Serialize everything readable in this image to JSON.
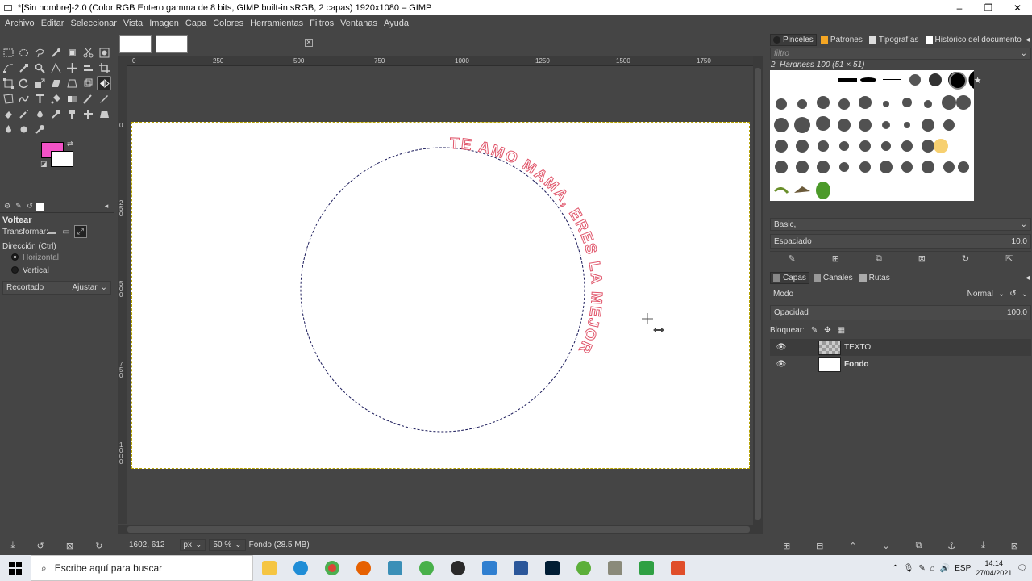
{
  "window": {
    "title": "*[Sin nombre]-2.0 (Color RGB Entero gamma de 8 bits, GIMP built-in sRGB, 2 capas) 1920x1080 – GIMP",
    "minimize": "–",
    "maximize": "❐",
    "close": "✕"
  },
  "menu": [
    "Archivo",
    "Editar",
    "Seleccionar",
    "Vista",
    "Imagen",
    "Capa",
    "Colores",
    "Herramientas",
    "Filtros",
    "Ventanas",
    "Ayuda"
  ],
  "colors": {
    "foreground": "#f252c6",
    "background": "#ffffff",
    "text_outline": "#e0556a",
    "accent": "#f5a623"
  },
  "tool_options": {
    "title": "Voltear",
    "transform_label": "Transformar:",
    "direction_label": "Dirección (Ctrl)",
    "horizontal": "Horizontal",
    "vertical": "Vertical",
    "clipping_label": "Recortado",
    "clipping_value": "Ajustar"
  },
  "rulers": {
    "top": [
      "0",
      "250",
      "500",
      "750",
      "1000",
      "1250",
      "1500",
      "1750"
    ],
    "left": [
      "0",
      "2 5 0",
      "5 0 0",
      "7 5 0",
      "1 0 0 0"
    ]
  },
  "canvas": {
    "circle_text": "TE AMO MAMA, ERES LA MEJOR"
  },
  "statusbar": {
    "coords": "1602, 612",
    "unit": "px",
    "zoom": "50 %",
    "layer_info": "Fondo (28.5 MB)"
  },
  "brushes": {
    "tabs": [
      "Pinceles",
      "Patrones",
      "Tipografías",
      "Histórico del documento"
    ],
    "filter_placeholder": "filtro",
    "current": "2. Hardness 100 (51 × 51)",
    "preset": "Basic,",
    "spacing_label": "Espaciado",
    "spacing_value": "10.0"
  },
  "layers": {
    "tabs": [
      "Capas",
      "Canales",
      "Rutas"
    ],
    "mode_label": "Modo",
    "mode_value": "Normal",
    "opacity_label": "Opacidad",
    "opacity_value": "100.0",
    "lock_label": "Bloquear:",
    "items": [
      {
        "name": "TEXTO"
      },
      {
        "name": "Fondo"
      }
    ]
  },
  "taskbar": {
    "search_placeholder": "Escribe aquí para buscar",
    "language": "ESP",
    "time": "14:14",
    "date": "27/04/2021"
  }
}
